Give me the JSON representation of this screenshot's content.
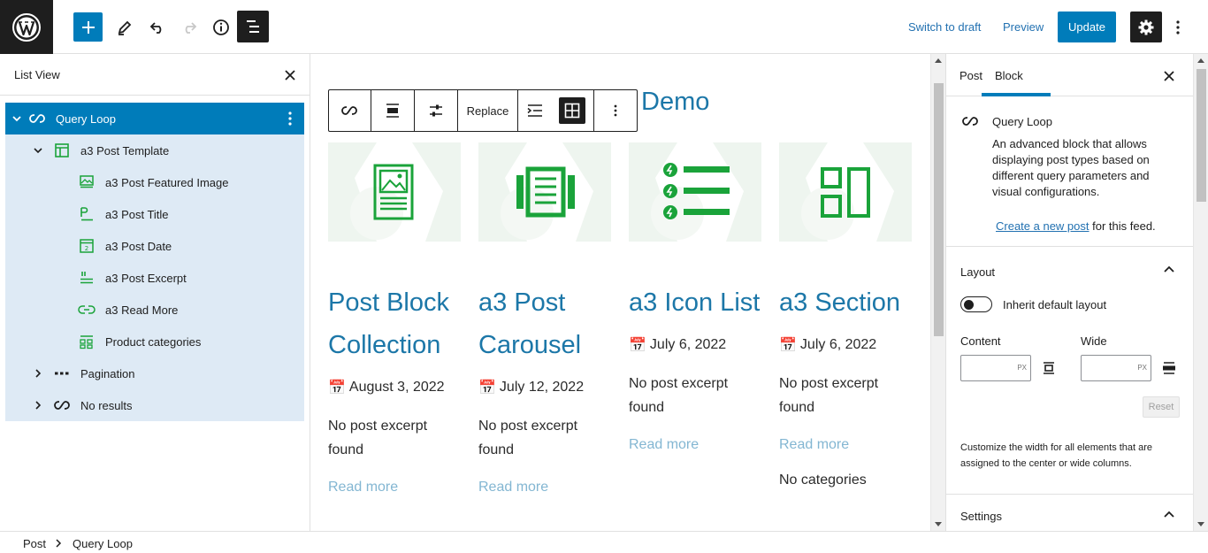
{
  "topbar": {
    "switch_to_draft": "Switch to draft",
    "preview": "Preview",
    "update": "Update"
  },
  "list_view": {
    "title": "List View",
    "items": [
      {
        "label": "Query Loop",
        "icon": "loop-icon"
      },
      {
        "label": "a3 Post Template",
        "icon": "layout-icon"
      },
      {
        "label": "a3 Post Featured Image",
        "icon": "image-icon"
      },
      {
        "label": "a3 Post Title",
        "icon": "title-icon"
      },
      {
        "label": "a3 Post Date",
        "icon": "calendar-icon"
      },
      {
        "label": "a3 Post Excerpt",
        "icon": "excerpt-icon"
      },
      {
        "label": "a3 Read More",
        "icon": "link-icon"
      },
      {
        "label": "Product categories",
        "icon": "categories-icon"
      },
      {
        "label": "Pagination",
        "icon": "pagination-icon"
      },
      {
        "label": "No results",
        "icon": "loop-icon"
      }
    ]
  },
  "block_toolbar": {
    "replace": "Replace"
  },
  "canvas": {
    "heading_fragment": "Demo",
    "accent_color": "#1c77a8",
    "icon_color": "#1aa33a",
    "posts": [
      {
        "title": "Post Block Collection",
        "date": "August 3, 2022",
        "excerpt": "No post excerpt found",
        "read_more": "Read more"
      },
      {
        "title": "a3 Post Carousel",
        "date": "July 12, 2022",
        "excerpt": "No post excerpt found",
        "read_more": "Read more"
      },
      {
        "title": "a3 Icon List",
        "date": "July 6, 2022",
        "excerpt": "No post excerpt found",
        "read_more": "Read more"
      },
      {
        "title": "a3 Section",
        "date": "July 6, 2022",
        "excerpt": "No post excerpt found",
        "read_more": "Read more",
        "categories": "No categories"
      }
    ]
  },
  "sidebar": {
    "tabs": [
      {
        "label": "Post"
      },
      {
        "label": "Block"
      }
    ],
    "block_name": "Query Loop",
    "block_description": "An advanced block that allows displaying post types based on different query parameters and visual configurations.",
    "create_link": "Create a new post",
    "create_suffix": " for this feed.",
    "layout": {
      "title": "Layout",
      "toggle_label": "Inherit default layout",
      "content_label": "Content",
      "wide_label": "Wide",
      "unit": "PX",
      "reset": "Reset",
      "help": "Customize the width for all elements that are assigned to the center or wide columns."
    },
    "settings_title": "Settings"
  },
  "breadcrumb": [
    "Post",
    "Query Loop"
  ]
}
